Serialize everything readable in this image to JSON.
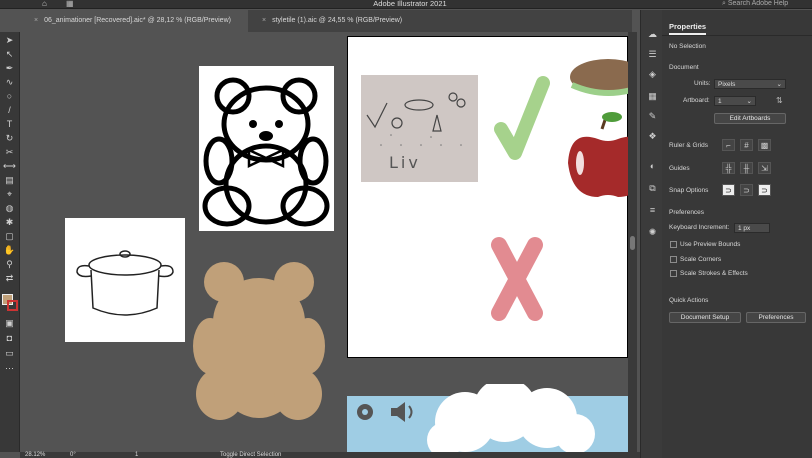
{
  "app": {
    "title": "Adobe Illustrator 2021",
    "search_placeholder": "Search Adobe Help"
  },
  "tabs": [
    {
      "label": "06_animationer [Recovered].aic* @ 28,12 % (RGB/Preview)",
      "active": true
    },
    {
      "label": "styletile (1).aic @ 24,55 % (RGB/Preview)",
      "active": false
    }
  ],
  "properties": {
    "panel_title": "Properties",
    "selection": "No Selection",
    "document_label": "Document",
    "units_label": "Units:",
    "units_value": "Pixels",
    "artboard_label": "Artboard:",
    "artboard_value": "1",
    "edit_artboards": "Edit Artboards",
    "ruler_grids": "Ruler & Grids",
    "guides": "Guides",
    "snap_options": "Snap Options",
    "preferences_label": "Preferences",
    "keyboard_increment_label": "Keyboard Increment:",
    "keyboard_increment_value": "1 px",
    "use_preview_bounds": "Use Preview Bounds",
    "scale_corners": "Scale Corners",
    "scale_strokes": "Scale Strokes & Effects",
    "quick_actions": "Quick Actions",
    "document_setup": "Document Setup",
    "preferences_button": "Preferences"
  },
  "status": {
    "zoom": "28.12%",
    "rotation": "0°",
    "artboard": "1",
    "tool": "Toggle Direct Selection"
  },
  "canvas": {
    "sketch_text": "Liv"
  },
  "colors": {
    "check": "#a6d28c",
    "cross": "#e28b91",
    "bear": "#c0a079",
    "banner": "#9fcde4",
    "apple": "#a52a2a"
  }
}
